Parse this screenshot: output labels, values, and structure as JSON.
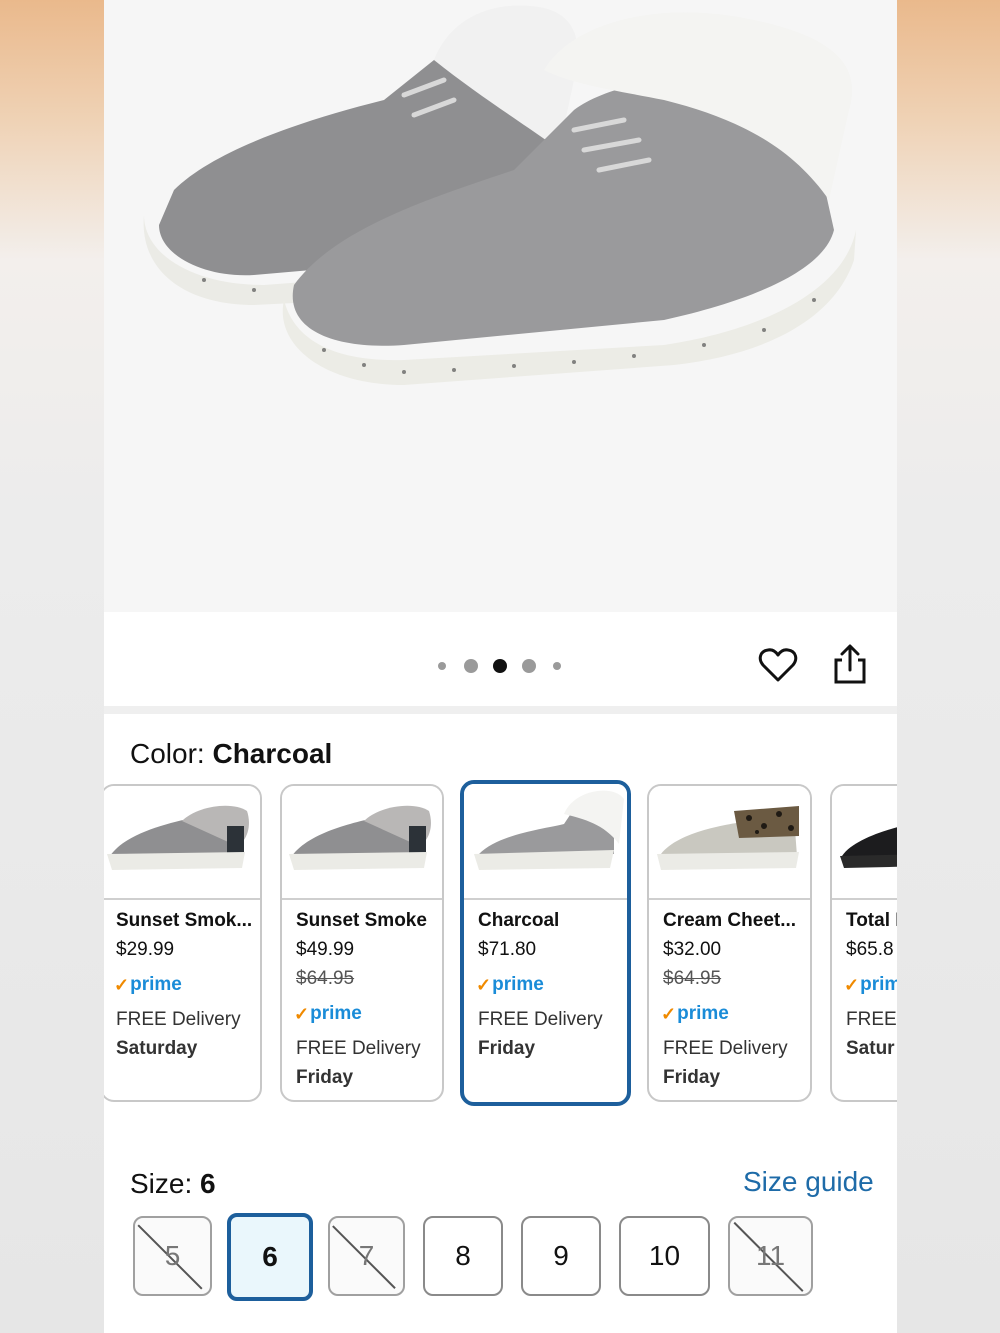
{
  "color_selector": {
    "label": "Color:",
    "value": "Charcoal"
  },
  "carousel": {
    "page_count": 5,
    "active_index": 2
  },
  "variants": [
    {
      "name": "Sunset Smok...",
      "price": "$29.99",
      "old_price": "",
      "prime": "prime",
      "delivery": "FREE Delivery",
      "day": "Saturday",
      "selected": false
    },
    {
      "name": "Sunset Smoke",
      "price": "$49.99",
      "old_price": "$64.95",
      "prime": "prime",
      "delivery": "FREE Delivery",
      "day": "Friday",
      "selected": false
    },
    {
      "name": "Charcoal",
      "price": "$71.80",
      "old_price": "",
      "prime": "prime",
      "delivery": "FREE Delivery",
      "day": "Friday",
      "selected": true
    },
    {
      "name": "Cream Cheet...",
      "price": "$32.00",
      "old_price": "$64.95",
      "prime": "prime",
      "delivery": "FREE Delivery",
      "day": "Friday",
      "selected": false
    },
    {
      "name": "Total B",
      "price": "$65.8",
      "old_price": "",
      "prime": "prim",
      "delivery": "FREE D",
      "day": "Satur",
      "selected": false
    }
  ],
  "size_selector": {
    "label": "Size:",
    "value": "6",
    "guide_label": "Size guide"
  },
  "sizes": [
    {
      "label": "5",
      "available": false,
      "selected": false
    },
    {
      "label": "6",
      "available": true,
      "selected": true
    },
    {
      "label": "7",
      "available": false,
      "selected": false
    },
    {
      "label": "8",
      "available": true,
      "selected": false
    },
    {
      "label": "9",
      "available": true,
      "selected": false
    },
    {
      "label": "10",
      "available": true,
      "selected": false
    },
    {
      "label": "11",
      "available": false,
      "selected": false
    }
  ],
  "colors": {
    "accent": "#1d5f9c",
    "link": "#1e6ba8",
    "prime_blue": "#1a8cd8",
    "prime_check": "#f08a00",
    "selected_bg": "#eaf7fc"
  },
  "icons": {
    "wishlist": "heart-icon",
    "share": "share-icon"
  }
}
